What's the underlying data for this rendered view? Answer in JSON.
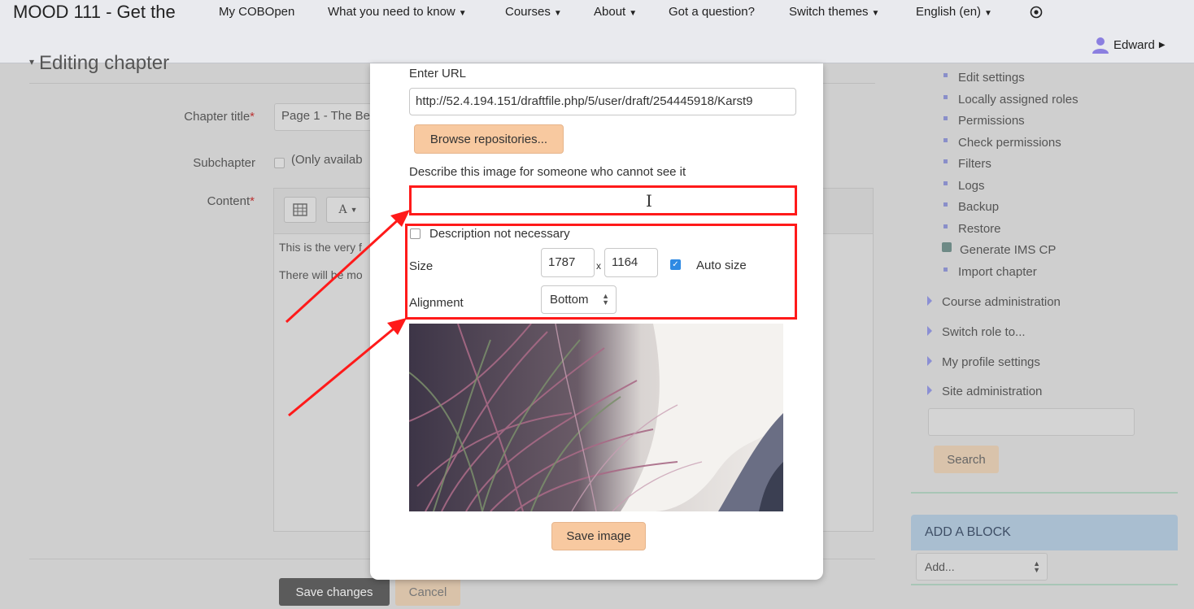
{
  "navbar": {
    "brand": "MOOD 111 - Get the",
    "items": [
      {
        "label": "My COBOpen",
        "has_caret": false
      },
      {
        "label": "What you need to know",
        "has_caret": true
      },
      {
        "label": "Courses",
        "has_caret": true
      },
      {
        "label": "About",
        "has_caret": true
      },
      {
        "label": "Got a question?",
        "has_caret": false
      },
      {
        "label": "Switch themes",
        "has_caret": true
      },
      {
        "label": "English (en)",
        "has_caret": true
      }
    ],
    "user_name": "Edward"
  },
  "editing_form": {
    "legend": "Editing chapter",
    "chapter_title_label": "Chapter title",
    "chapter_title_value": "Page 1 - The Be",
    "subchapter_label": "Subchapter",
    "subchapter_note": "(Only availab",
    "content_label": "Content",
    "content_lines": [
      "This is the very f",
      "There will be mo"
    ],
    "save_changes_label": "Save changes",
    "cancel_label": "Cancel"
  },
  "admin_menu": {
    "items": [
      {
        "label": "Edit settings",
        "icon": "bullet-icon"
      },
      {
        "label": "Locally assigned roles",
        "icon": "bullet-icon"
      },
      {
        "label": "Permissions",
        "icon": "bullet-icon"
      },
      {
        "label": "Check permissions",
        "icon": "bullet-icon"
      },
      {
        "label": "Filters",
        "icon": "bullet-icon"
      },
      {
        "label": "Logs",
        "icon": "bullet-icon"
      },
      {
        "label": "Backup",
        "icon": "bullet-icon"
      },
      {
        "label": "Restore",
        "icon": "bullet-icon"
      },
      {
        "label": "Generate IMS CP",
        "icon": "package-icon"
      },
      {
        "label": "Import chapter",
        "icon": "bullet-icon"
      }
    ],
    "sections": [
      "Course administration",
      "Switch role to...",
      "My profile settings",
      "Site administration"
    ],
    "search_button": "Search"
  },
  "add_block": {
    "title": "ADD A BLOCK",
    "select_value": "Add..."
  },
  "image_dialog": {
    "url_label": "Enter URL",
    "url_value": "http://52.4.194.151/draftfile.php/5/user/draft/254445918/Karst9",
    "browse_label": "Browse repositories...",
    "describe_label": "Describe this image for someone who cannot see it",
    "describe_value": "",
    "description_not_necessary_label": "Description not necessary",
    "description_not_necessary_checked": false,
    "size_label": "Size",
    "width": "1787",
    "times": "x",
    "height": "1164",
    "auto_size_label": "Auto size",
    "auto_size_checked": true,
    "alignment_label": "Alignment",
    "alignment_value": "Bottom",
    "save_image_label": "Save image"
  },
  "colors": {
    "annotation_red": "#ff1a1a",
    "button_peach": "#f8c9a0",
    "checkbox_blue": "#2f8ae3"
  }
}
